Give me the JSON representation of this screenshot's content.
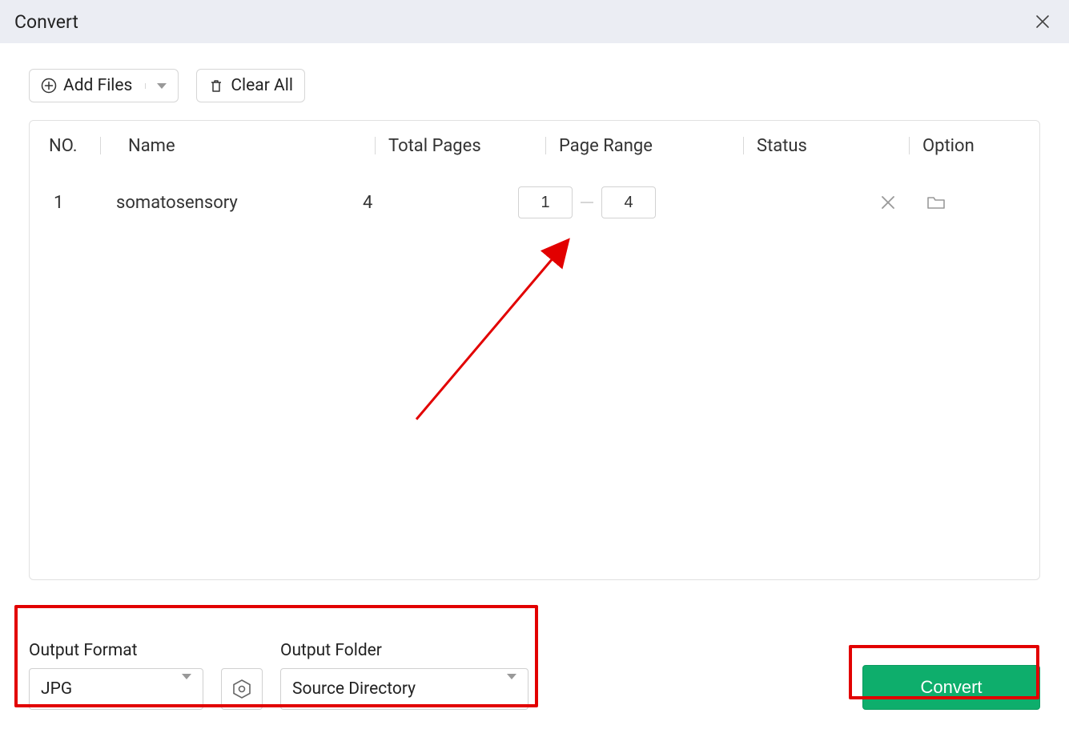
{
  "window": {
    "title": "Convert"
  },
  "toolbar": {
    "add_files_label": "Add Files",
    "clear_all_label": "Clear All"
  },
  "table": {
    "headers": {
      "no": "NO.",
      "name": "Name",
      "total": "Total Pages",
      "range": "Page Range",
      "status": "Status",
      "option": "Option"
    },
    "rows": [
      {
        "no": "1",
        "name": "somatosensory",
        "total": "4",
        "range_from": "1",
        "range_to": "4",
        "status": ""
      }
    ]
  },
  "output": {
    "format_label": "Output Format",
    "format_value": "JPG",
    "folder_label": "Output Folder",
    "folder_value": "Source Directory"
  },
  "actions": {
    "convert_label": "Convert"
  }
}
